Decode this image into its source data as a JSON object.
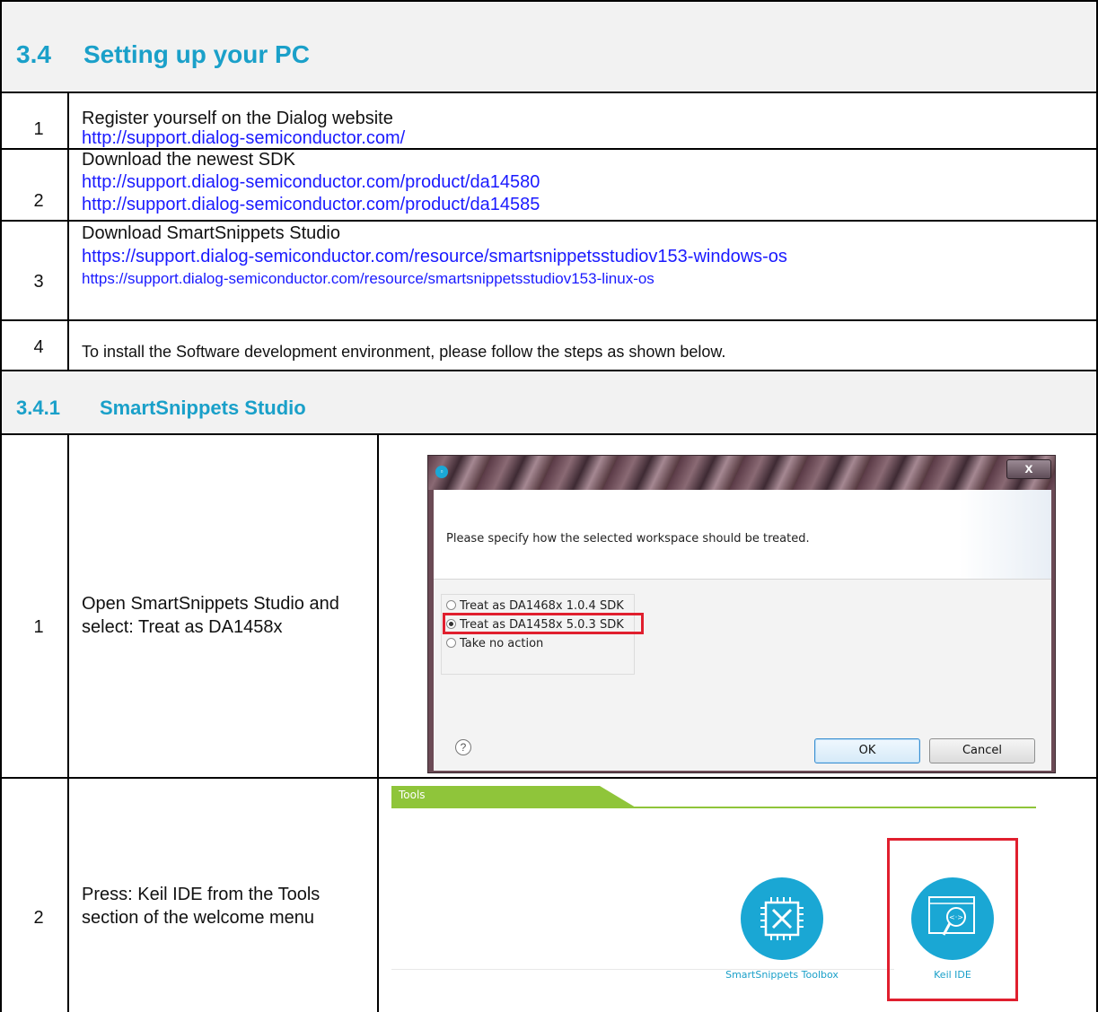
{
  "section": {
    "number": "3.4",
    "title": "Setting up your PC"
  },
  "steps": [
    {
      "num": "1",
      "lines": [
        "Register yourself on the Dialog website"
      ],
      "links": [
        "http://support.dialog-semiconductor.com/"
      ]
    },
    {
      "num": "2",
      "lines": [
        "Download the newest SDK"
      ],
      "links": [
        "http://support.dialog-semiconductor.com/product/da14580",
        "http://support.dialog-semiconductor.com/product/da14585"
      ]
    },
    {
      "num": "3",
      "lines": [
        "Download SmartSnippets Studio"
      ],
      "links": [
        "https://support.dialog-semiconductor.com/resource/smartsnippetsstudiov153-windows-os",
        "https://support.dialog-semiconductor.com/resource/smartsnippetsstudiov153-linux-os"
      ]
    },
    {
      "num": "4",
      "lines": [
        "To install the Software development environment, please follow the steps as shown below."
      ],
      "links": []
    }
  ],
  "subsection": {
    "number": "3.4.1",
    "title": "SmartSnippets Studio"
  },
  "substeps": [
    {
      "num": "1",
      "text": "Open SmartSnippets Studio and select: Treat as DA1458x"
    },
    {
      "num": "2",
      "text": "Press: Keil IDE from the Tools section of the welcome menu"
    }
  ],
  "dialog": {
    "prompt": "Please specify how the selected workspace should be treated.",
    "options": [
      "Treat as DA1468x 1.0.4 SDK",
      "Treat as DA1458x 5.0.3 SDK",
      "Take no action"
    ],
    "selected": "Treat as DA1458x 5.0.3 SDK",
    "ok_label": "OK",
    "cancel_label": "Cancel",
    "close_glyph": "x",
    "help_glyph": "?"
  },
  "tools_panel": {
    "header": "Tools",
    "items": [
      {
        "label": "SmartSnippets Toolbox",
        "icon": "toolbox-icon"
      },
      {
        "label": "Keil IDE",
        "icon": "keil-ide-icon"
      }
    ],
    "accent": "#8fc53a",
    "icon_color": "#1aa7d4"
  },
  "colors": {
    "heading": "#1aa0c9",
    "link": "#1a1aff",
    "highlight": "#e01f2e"
  }
}
